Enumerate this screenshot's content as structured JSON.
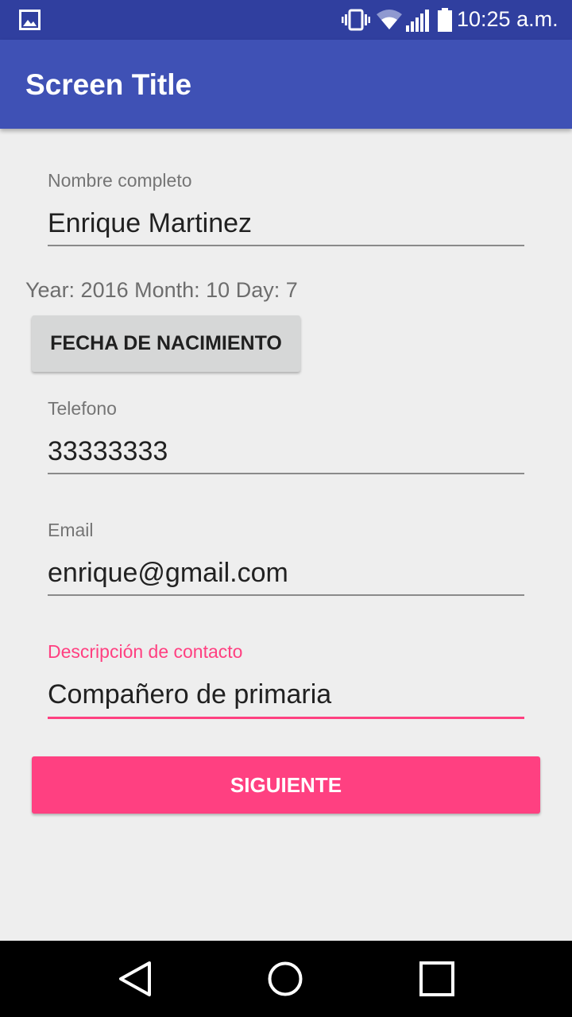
{
  "status_bar": {
    "time": "10:25 a.m.",
    "icons": [
      "image-icon",
      "vibrate-icon",
      "wifi-icon",
      "signal-icon",
      "battery-icon"
    ]
  },
  "app_bar": {
    "title": "Screen Title"
  },
  "form": {
    "name": {
      "label": "Nombre completo",
      "value": "Enrique Martinez"
    },
    "date_text": "Year: 2016 Month: 10 Day: 7",
    "date_button": "FECHA DE NACIMIENTO",
    "phone": {
      "label": "Telefono",
      "value": "33333333"
    },
    "email": {
      "label": "Email",
      "value": "enrique@gmail.com"
    },
    "description": {
      "label": "Descripción de contacto",
      "value": "Compañero de primaria",
      "focused": true
    },
    "next_button": "SIGUIENTE"
  },
  "nav_bar": {
    "icons": [
      "back-icon",
      "home-icon",
      "recents-icon"
    ]
  },
  "colors": {
    "primary": "#3f51b5",
    "primary_dark": "#303f9f",
    "accent": "#ff4081",
    "background": "#eeeeee"
  }
}
